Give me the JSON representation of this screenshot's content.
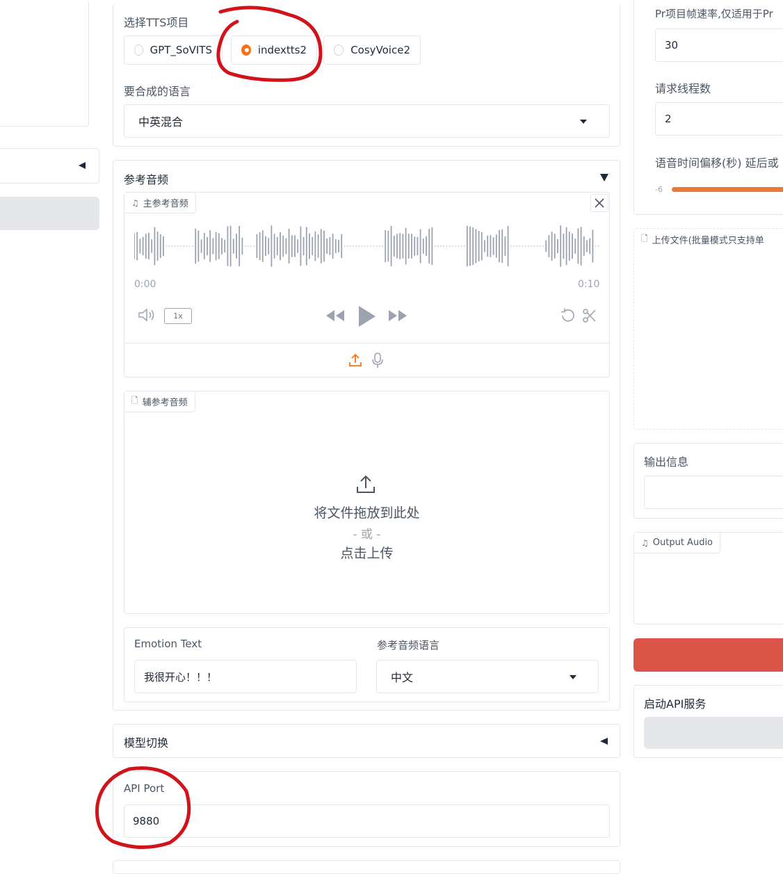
{
  "tts": {
    "label": "选择TTS项目",
    "options": [
      "GPT_SoVITS",
      "indextts2",
      "CosyVoice2"
    ],
    "selected": "indextts2"
  },
  "language": {
    "label": "要合成的语言",
    "value": "中英混合"
  },
  "ref_audio": {
    "section_title": "参考音频",
    "main_tag": "主参考音频",
    "time_start": "0:00",
    "time_end": "0:10",
    "speed": "1x",
    "aux_tag": "辅参考音频",
    "drop_text": "将文件拖放到此处",
    "or_text": "- 或 -",
    "click_text": "点击上传"
  },
  "emotion": {
    "label": "Emotion Text",
    "value": "我很开心！！！"
  },
  "ref_lang": {
    "label": "参考音频语言",
    "value": "中文"
  },
  "model_switch": {
    "title": "模型切换"
  },
  "api_port": {
    "label": "API Port",
    "value": "9880"
  },
  "right": {
    "fps_label": "Pr项目帧速率,仅适用于Pr",
    "fps_value": "30",
    "threads_label": "请求线程数",
    "threads_value": "2",
    "offset_label": "语音时间偏移(秒) 延后或",
    "offset_min": "-6",
    "upload_tag": "上传文件(批量模式只支持单",
    "output_info_label": "输出信息",
    "output_audio_tag": "Output Audio",
    "api_service_label": "启动API服务"
  },
  "colors": {
    "accent": "#f97316",
    "red_button": "#dc5347",
    "annotation": "#d0141c"
  }
}
